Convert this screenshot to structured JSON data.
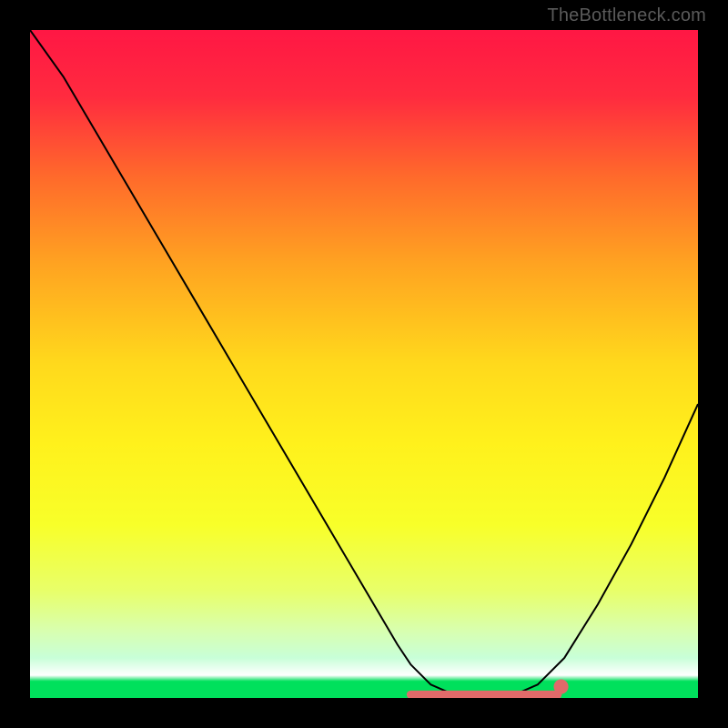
{
  "watermark": {
    "text": "TheBottleneck.com",
    "color": "#5a5a5a"
  },
  "chart_data": {
    "type": "line",
    "title": "",
    "xlabel": "",
    "ylabel": "",
    "xlim": [
      0,
      100
    ],
    "ylim": [
      0,
      100
    ],
    "x": [
      0,
      5,
      10,
      15,
      20,
      25,
      30,
      35,
      40,
      45,
      50,
      55,
      57,
      60,
      63,
      67,
      70,
      73,
      76,
      80,
      85,
      90,
      95,
      100
    ],
    "values": [
      100,
      93,
      84.5,
      76,
      67.5,
      59,
      50.5,
      42,
      33.5,
      25,
      16.5,
      8,
      5,
      2,
      0.7,
      0.3,
      0.3,
      0.7,
      2,
      6,
      14,
      23,
      33,
      44
    ],
    "gradient_stops": [
      {
        "offset": 0.0,
        "color": "#ff1744"
      },
      {
        "offset": 0.1,
        "color": "#ff2b3f"
      },
      {
        "offset": 0.22,
        "color": "#ff6a2b"
      },
      {
        "offset": 0.35,
        "color": "#ffa321"
      },
      {
        "offset": 0.5,
        "color": "#ffd91c"
      },
      {
        "offset": 0.62,
        "color": "#fff11c"
      },
      {
        "offset": 0.74,
        "color": "#f8ff29"
      },
      {
        "offset": 0.84,
        "color": "#e8ff6a"
      },
      {
        "offset": 0.9,
        "color": "#d8ffb0"
      },
      {
        "offset": 0.94,
        "color": "#c8ffd8"
      },
      {
        "offset": 0.966,
        "color": "#ffffff"
      },
      {
        "offset": 0.975,
        "color": "#00e05c"
      },
      {
        "offset": 1.0,
        "color": "#00e05c"
      }
    ],
    "marker_band": {
      "y": 0.5,
      "x_start": 57,
      "x_end": 79,
      "color": "#e06a6a",
      "end_dot_x": 79.5,
      "end_dot_r": 1.1
    },
    "curve_stroke": "#000000",
    "curve_width": 2
  }
}
